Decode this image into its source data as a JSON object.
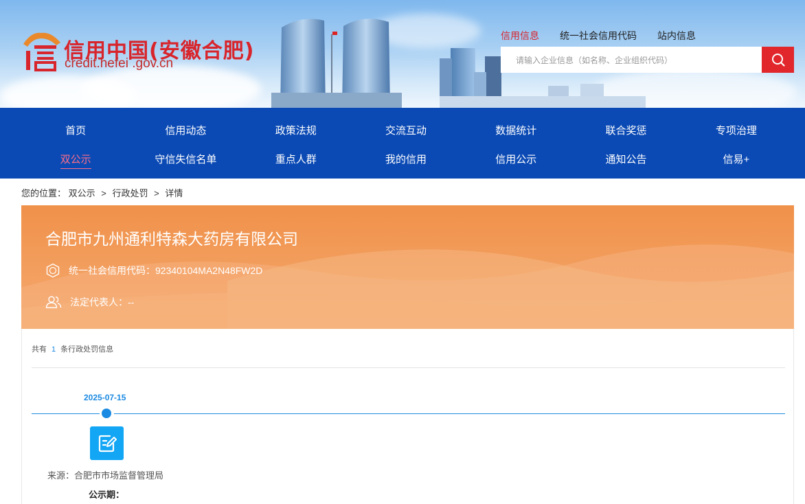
{
  "header": {
    "site_title": "信用中国(安徽合肥)",
    "site_url": "credit.hefei .gov.cn",
    "logo_icon": "credit-logo-icon",
    "top_tabs": [
      {
        "label": "信用信息",
        "active": true
      },
      {
        "label": "统一社会信用代码",
        "active": false
      },
      {
        "label": "站内信息",
        "active": false
      }
    ],
    "search": {
      "placeholder": "请输入企业信息（如名称、企业组织代码）",
      "button_icon": "search-icon"
    }
  },
  "nav": {
    "row1": [
      "首页",
      "信用动态",
      "政策法规",
      "交流互动",
      "数据统计",
      "联合奖惩",
      "专项治理"
    ],
    "row2": [
      "双公示",
      "守信失信名单",
      "重点人群",
      "我的信用",
      "信用公示",
      "通知公告",
      "信易+"
    ],
    "active": "双公示"
  },
  "breadcrumb": {
    "prefix": "您的位置：",
    "items": [
      "双公示",
      "行政处罚",
      "详情"
    ],
    "separator": ">"
  },
  "company": {
    "name": "合肥市九州通利特森大药房有限公司",
    "credit_code_label": "统一社会信用代码：",
    "credit_code": "92340104MA2N48FW2D",
    "legal_rep_label": "法定代表人：",
    "legal_rep": "--"
  },
  "records": {
    "count_prefix": "共有",
    "count": "1",
    "count_suffix": "条行政处罚信息",
    "items": [
      {
        "date": "2025-07-15",
        "icon": "edit-document-icon",
        "source_label": "来源：",
        "source": "合肥市市场监督管理局",
        "period_label": "公示期："
      }
    ]
  },
  "colors": {
    "brand_red": "#d8242b",
    "nav_blue": "#0b4ab5",
    "card_orange": "#f0914a",
    "accent_blue": "#1b8ae2"
  }
}
